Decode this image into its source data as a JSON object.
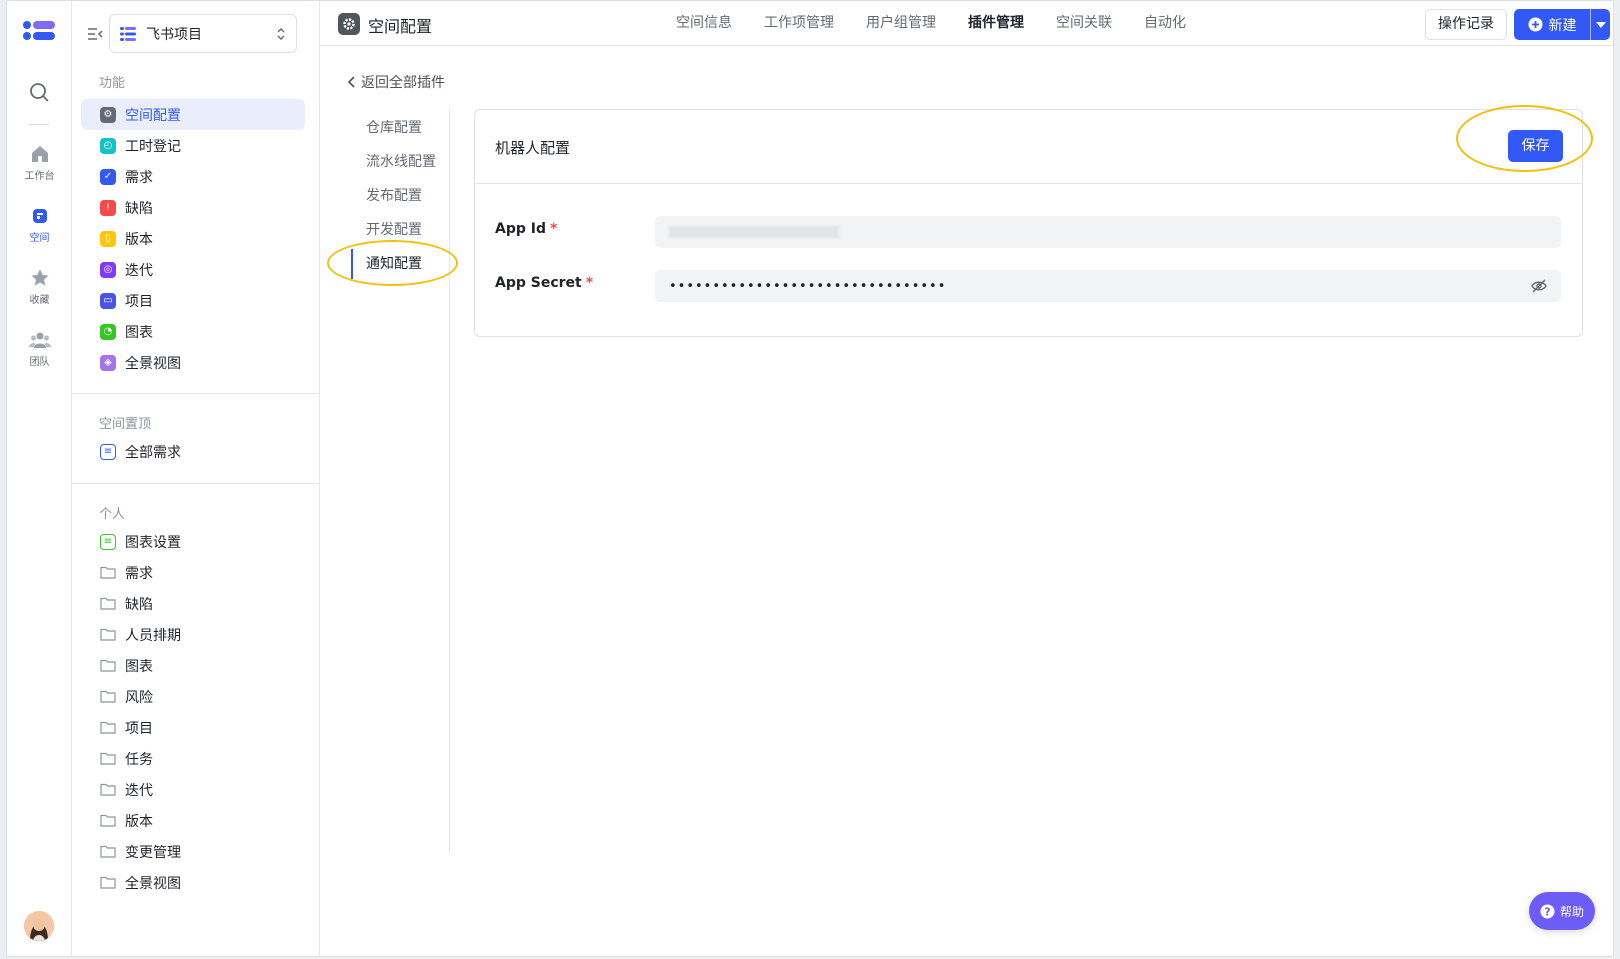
{
  "rail": {
    "items": [
      {
        "label": "工作台"
      },
      {
        "label": "空间"
      },
      {
        "label": "收藏"
      },
      {
        "label": "团队"
      }
    ]
  },
  "sidebar": {
    "project_name": "飞书项目",
    "sections": {
      "features_title": "功能",
      "pinned_title": "空间置顶",
      "personal_title": "个人"
    },
    "features": [
      {
        "label": "空间配置",
        "color": "#646a73"
      },
      {
        "label": "工时登记",
        "color": "#14c0c9"
      },
      {
        "label": "需求",
        "color": "#3259f5"
      },
      {
        "label": "缺陷",
        "color": "#f54a45"
      },
      {
        "label": "版本",
        "color": "#ffc60a"
      },
      {
        "label": "迭代",
        "color": "#7f3bf5"
      },
      {
        "label": "项目",
        "color": "#4954e6"
      },
      {
        "label": "图表",
        "color": "#34c724"
      },
      {
        "label": "全景视图",
        "color": "#a673f0"
      }
    ],
    "pinned": [
      {
        "label": "全部需求"
      }
    ],
    "personal": [
      {
        "label": "图表设置"
      },
      {
        "label": "需求"
      },
      {
        "label": "缺陷"
      },
      {
        "label": "人员排期"
      },
      {
        "label": "图表"
      },
      {
        "label": "风险"
      },
      {
        "label": "项目"
      },
      {
        "label": "任务"
      },
      {
        "label": "迭代"
      },
      {
        "label": "版本"
      },
      {
        "label": "变更管理"
      },
      {
        "label": "全景视图"
      }
    ]
  },
  "topbar": {
    "title": "空间配置",
    "tabs": [
      {
        "label": "空间信息"
      },
      {
        "label": "工作项管理"
      },
      {
        "label": "用户组管理"
      },
      {
        "label": "插件管理"
      },
      {
        "label": "空间关联"
      },
      {
        "label": "自动化"
      }
    ],
    "log_button": "操作记录",
    "new_button": "新建"
  },
  "content": {
    "back_link": "返回全部插件",
    "subnav": [
      {
        "label": "仓库配置"
      },
      {
        "label": "流水线配置"
      },
      {
        "label": "发布配置"
      },
      {
        "label": "开发配置"
      },
      {
        "label": "通知配置"
      }
    ],
    "card": {
      "title": "机器人配置",
      "save_button": "保存",
      "app_id_label": "App Id",
      "app_secret_label": "App Secret",
      "required_mark": "*",
      "app_secret_value": "••••••••••••••••••••••••••••••••"
    }
  },
  "help_button": "帮助",
  "colors": {
    "accent": "#3259f5",
    "annotation": "#f3c10d",
    "help": "#6e5cf6"
  }
}
